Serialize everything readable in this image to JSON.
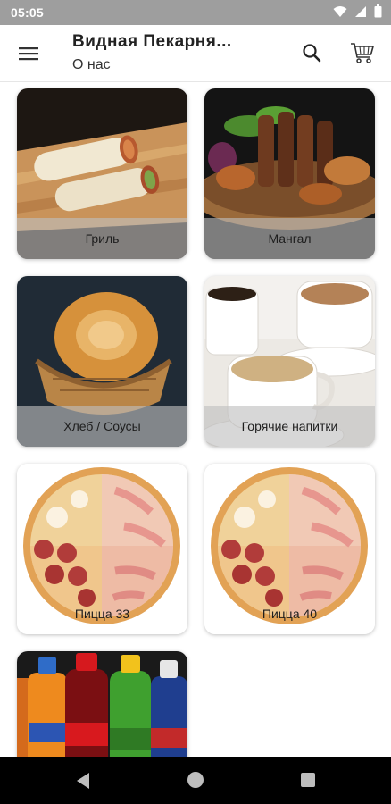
{
  "status_bar": {
    "time": "05:05",
    "icons": [
      "wifi-icon",
      "signal-icon",
      "battery-icon"
    ]
  },
  "app_bar": {
    "title": "Видная Пекарня...",
    "subtitle": "О нас",
    "icons": [
      "menu-icon",
      "search-icon",
      "cart-icon"
    ]
  },
  "categories": [
    {
      "label": "Гриль"
    },
    {
      "label": "Мангал"
    },
    {
      "label": "Хлеб / Соусы"
    },
    {
      "label": "Горячие напитки"
    },
    {
      "label": "Пицца 33"
    },
    {
      "label": "Пицца 40"
    },
    {
      "label": ""
    }
  ],
  "nav_bar": {
    "icons": [
      "back-icon",
      "home-icon",
      "recent-apps-icon"
    ]
  }
}
